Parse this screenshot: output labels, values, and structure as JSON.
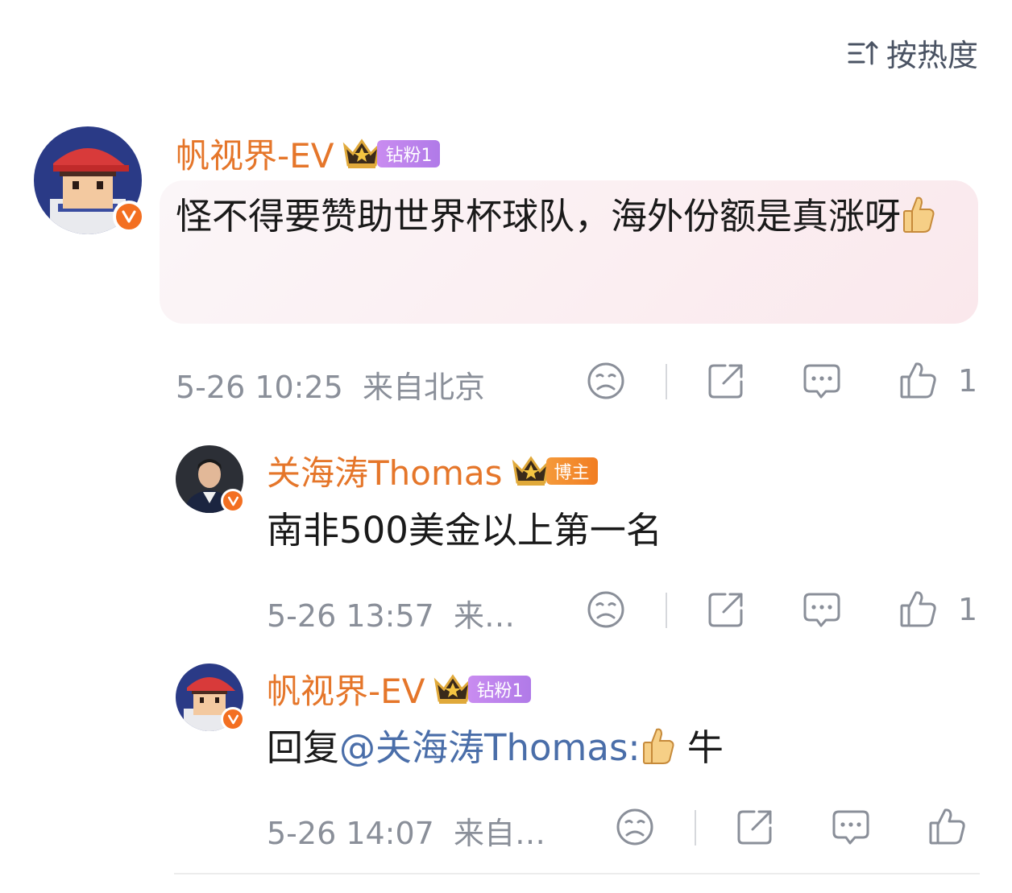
{
  "header": {
    "sort_label": "按热度"
  },
  "comments": [
    {
      "username": "帆视界-EV",
      "badge": "钻粉1",
      "text": "怪不得要赞助世界杯球队，海外份额是真涨呀",
      "timestamp": "5-26 10:25",
      "location": "来自北京",
      "likes": "1"
    },
    {
      "username": "关海涛Thomas",
      "badge": "博主",
      "text": "南非500美金以上第一名",
      "timestamp": "5-26 13:57",
      "location": "来…",
      "likes": "1"
    },
    {
      "username": "帆视界-EV",
      "badge": "钻粉1",
      "reply_prefix": "回复",
      "mention": "@关海涛Thomas:",
      "text": "牛",
      "timestamp": "5-26 14:07",
      "location": "来自…",
      "likes": ""
    }
  ],
  "icons": [
    "sort-icon",
    "sad-face-icon",
    "share-icon",
    "comment-icon",
    "thumbs-up-icon",
    "thumbs-up-emoji",
    "crown-icon",
    "verified-v-icon"
  ],
  "colors": {
    "username": "#e5762a",
    "mention": "#4a6ea9",
    "meta": "#8a8f99",
    "badge_purple": "#b07ae8",
    "badge_orange": "#f17d22",
    "verified": "#f36f21"
  }
}
